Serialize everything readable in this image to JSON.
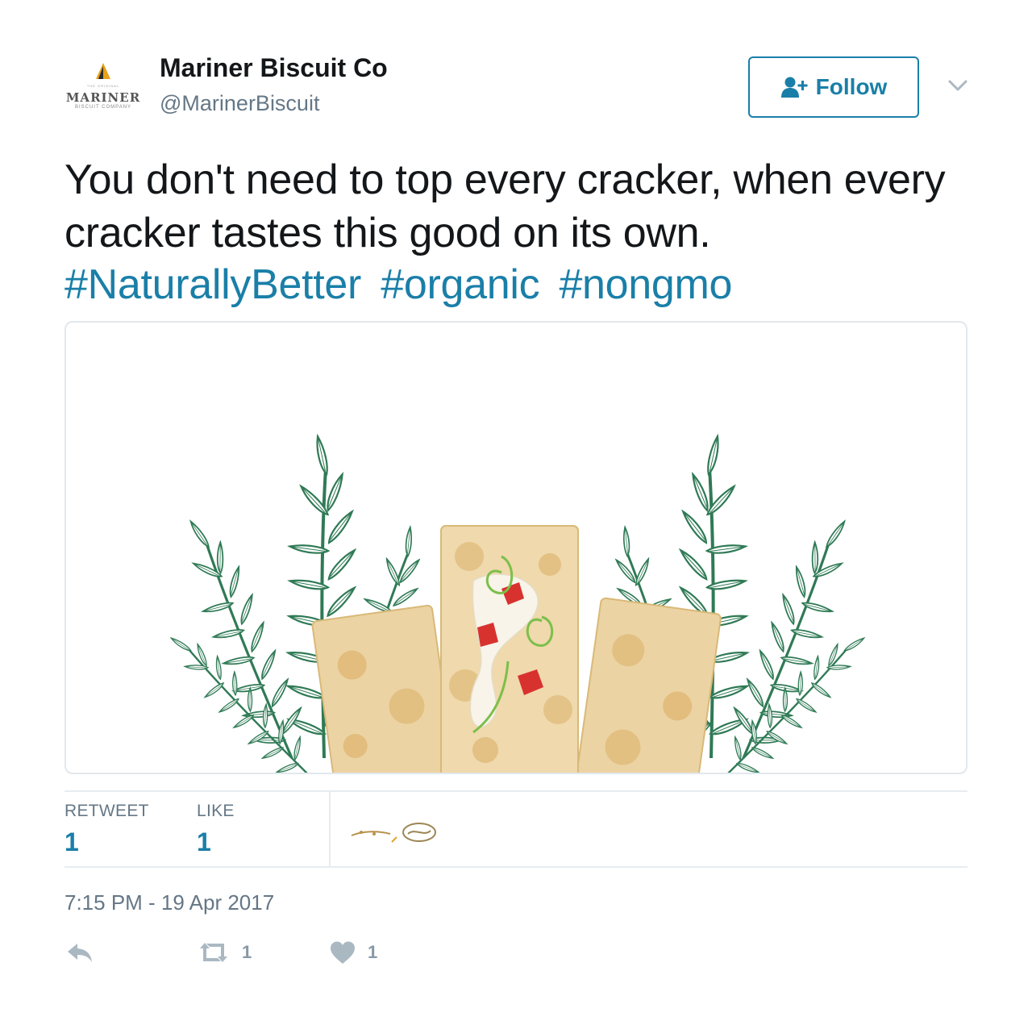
{
  "account": {
    "name": "Mariner Biscuit Co",
    "handle": "@MarinerBiscuit",
    "avatar_text": "MARINER",
    "avatar_subtext": "BISCUIT COMPANY",
    "avatar_tiny": "THE ORIGINAL"
  },
  "follow_button": {
    "label": "Follow",
    "icon": "add-user-icon"
  },
  "menu": {
    "icon": "chevron-down-icon"
  },
  "tweet": {
    "text": "You don't need to top every cracker, when every cracker tastes this good on its own.",
    "hashtags": [
      "#NaturallyBetter",
      "#organic",
      "#nongmo"
    ]
  },
  "stats": {
    "retweet_label": "RETWEET",
    "retweet_count": "1",
    "like_label": "LIKE",
    "like_count": "1"
  },
  "timestamp": "7:15 PM - 19 Apr 2017",
  "actions": {
    "reply_icon": "reply-icon",
    "retweet_icon": "retweet-icon",
    "retweet_count": "1",
    "like_icon": "heart-icon",
    "like_count": "1"
  },
  "colors": {
    "link": "#1a7fa8",
    "muted": "#657786",
    "border": "#e6ecf0",
    "herb_green": "#2f7a55",
    "cracker": "#e9cf9f"
  }
}
